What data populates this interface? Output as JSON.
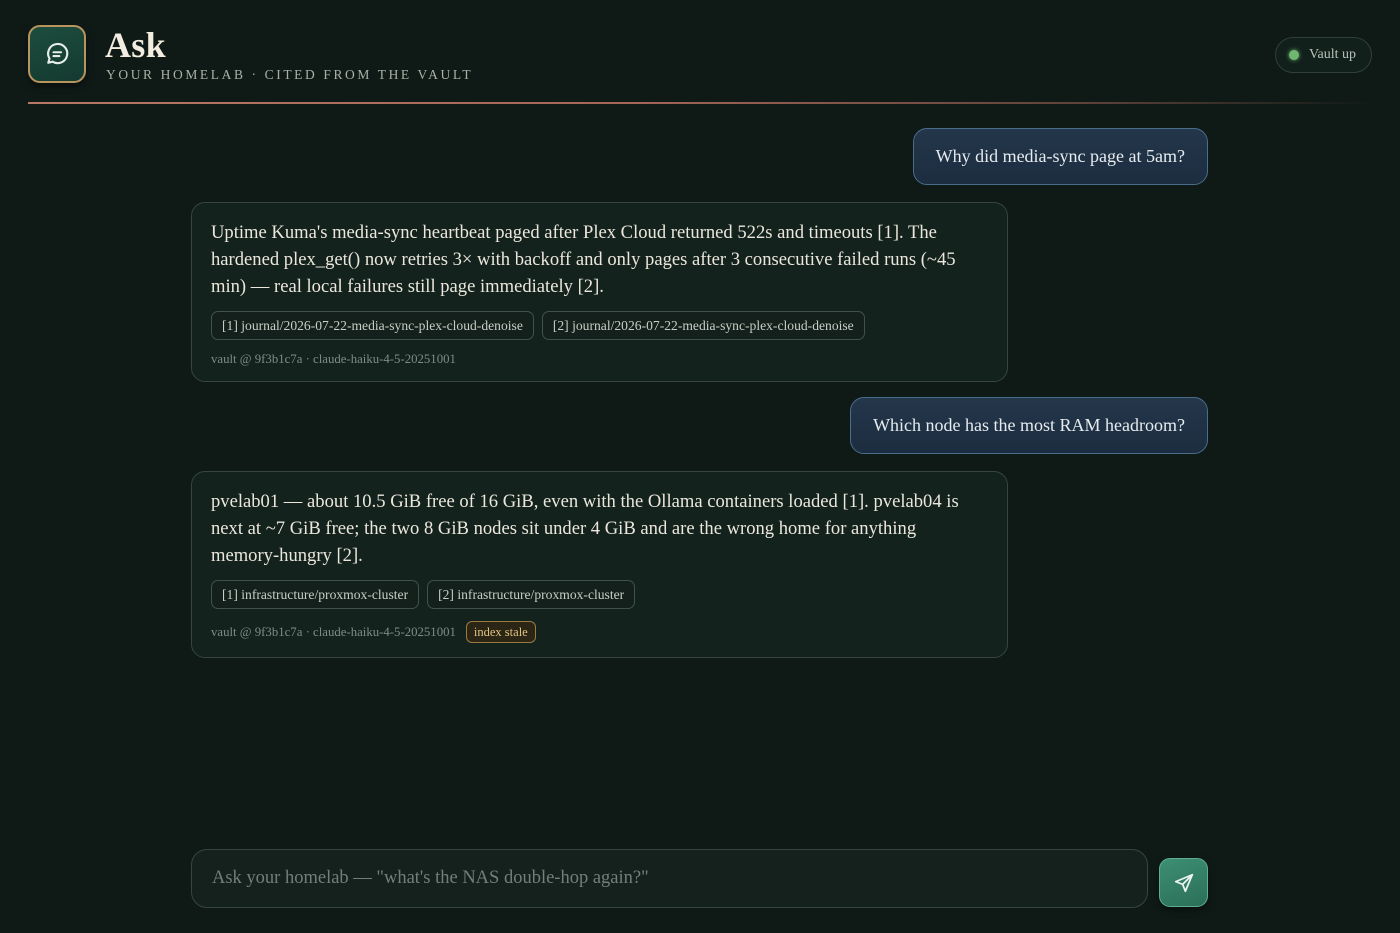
{
  "header": {
    "title": "Ask",
    "subtitle": "YOUR HOMELAB · CITED FROM THE VAULT",
    "logo_icon": "chat-bubble-icon",
    "status": {
      "label": "Vault up",
      "color": "#6fb96f"
    }
  },
  "conversation": [
    {
      "role": "user",
      "text": "Why did media-sync page at 5am?"
    },
    {
      "role": "assistant",
      "text": "Uptime Kuma's media-sync heartbeat paged after Plex Cloud returned 522s and timeouts [1]. The hardened plex_get() now retries 3× with backoff and only pages after 3 consecutive failed runs (~45 min) — real local failures still page immediately [2].",
      "citations": [
        "[1] journal/2026-07-22-media-sync-plex-cloud-denoise",
        "[2] journal/2026-07-22-media-sync-plex-cloud-denoise"
      ],
      "meta": "vault @ 9f3b1c7a · claude-haiku-4-5-20251001",
      "badge": null
    },
    {
      "role": "user",
      "text": "Which node has the most RAM headroom?"
    },
    {
      "role": "assistant",
      "text": "pvelab01 — about 10.5 GiB free of 16 GiB, even with the Ollama containers loaded [1]. pvelab04 is next at ~7 GiB free; the two 8 GiB nodes sit under 4 GiB and are the wrong home for anything memory-hungry [2].",
      "citations": [
        "[1] infrastructure/proxmox-cluster",
        "[2] infrastructure/proxmox-cluster"
      ],
      "meta": "vault @ 9f3b1c7a · claude-haiku-4-5-20251001",
      "badge": "index stale"
    }
  ],
  "composer": {
    "placeholder": "Ask your homelab — \"what's the NAS double-hop again?\"",
    "value": "",
    "send_icon": "send-icon"
  },
  "colors": {
    "background": "#0f1a17",
    "accent": "#3d8f73",
    "user_bubble": "#24364a",
    "badge": "#e2c37f"
  }
}
